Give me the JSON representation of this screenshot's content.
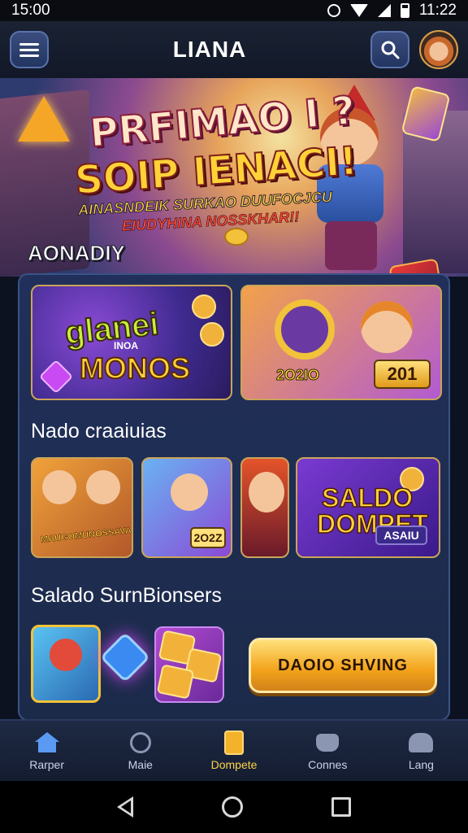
{
  "status_bar": {
    "time": "15:00",
    "right_time": "11:22"
  },
  "app_bar": {
    "title": "LIANA"
  },
  "hero": {
    "headline_1": "PRFIMAO I ?",
    "headline_2": "SOIP IENACI!",
    "tagline_1": "AINASNDEIK SURKAO DUUFOCJCU",
    "tagline_2": "EIUDYHINA NOSSKHAR!!",
    "section_label": "AONADIY"
  },
  "featured": {
    "tile_1": {
      "line_1": "glanei",
      "line_2": "INOA",
      "line_3": "MONOS"
    },
    "tile_2": {
      "code": "2O2IO",
      "badge": "201"
    }
  },
  "section_1": {
    "title": "Nado craaiuias",
    "tile_1_label": "MAUGOMUNOSSAVA",
    "tile_2_badge": "2O2Z",
    "tile_4": {
      "line_1": "SALDO",
      "line_2": "DOMPET",
      "badge": "ASAIU"
    }
  },
  "section_2": {
    "title": "Salado SurnBionsers",
    "cta_label": "DAOIO SHVING"
  },
  "bottom_nav": [
    {
      "label": "Rarper",
      "icon": "home-icon"
    },
    {
      "label": "Maie",
      "icon": "music-icon"
    },
    {
      "label": "Dompete",
      "icon": "document-icon"
    },
    {
      "label": "Connes",
      "icon": "game-icon"
    },
    {
      "label": "Lang",
      "icon": "users-icon"
    }
  ],
  "colors": {
    "accent": "#ffd24a",
    "panel": "#21305a",
    "cta": "#f2a21a"
  }
}
